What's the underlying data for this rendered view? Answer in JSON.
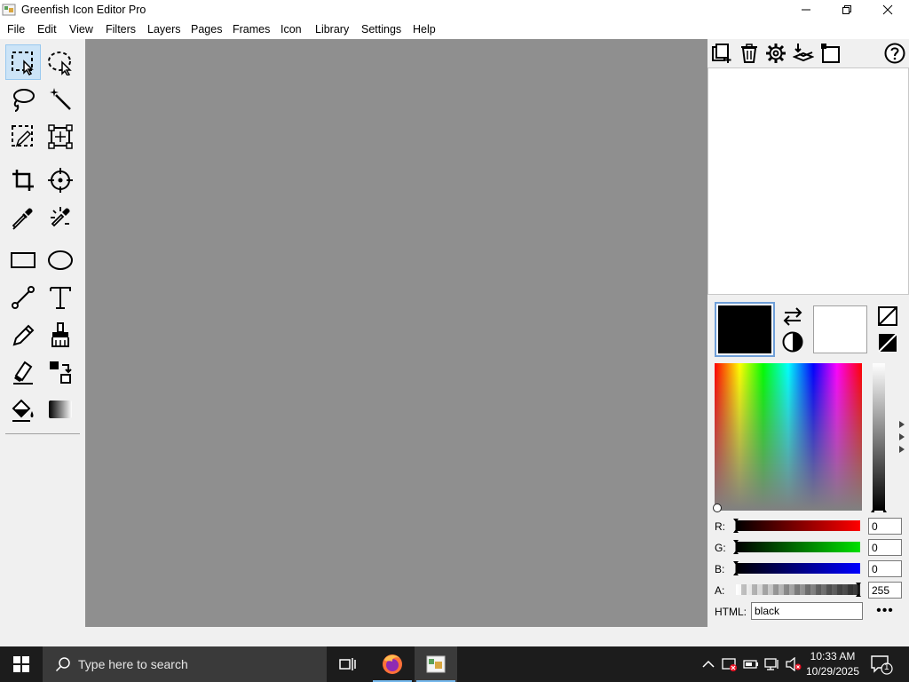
{
  "window": {
    "title": "Greenfish Icon Editor Pro",
    "icon": "app-icon"
  },
  "menu": [
    "File",
    "Edit",
    "View",
    "Filters",
    "Layers",
    "Pages",
    "Frames",
    "Icon",
    "Library",
    "Settings",
    "Help"
  ],
  "tools": [
    {
      "name": "rectangle-select-tool",
      "icon": "rect-select-icon",
      "active": true
    },
    {
      "name": "ellipse-select-tool",
      "icon": "ellipse-select-icon"
    },
    {
      "name": "lasso-tool",
      "icon": "lasso-icon"
    },
    {
      "name": "magic-wand-tool",
      "icon": "magic-wand-icon"
    },
    {
      "name": "draw-selection-tool",
      "icon": "pencil-select-icon"
    },
    {
      "name": "transform-tool",
      "icon": "transform-icon"
    },
    {
      "name": "crop-tool",
      "icon": "crop-icon"
    },
    {
      "name": "hotspot-tool",
      "icon": "target-icon"
    },
    {
      "name": "color-picker-tool",
      "icon": "eyedropper-icon"
    },
    {
      "name": "smart-picker-tool",
      "icon": "picker-spark-icon"
    },
    {
      "name": "rectangle-tool",
      "icon": "rectangle-icon"
    },
    {
      "name": "ellipse-tool",
      "icon": "ellipse-icon"
    },
    {
      "name": "line-tool",
      "icon": "line-icon"
    },
    {
      "name": "text-tool",
      "icon": "text-icon"
    },
    {
      "name": "pencil-tool",
      "icon": "pencil-icon"
    },
    {
      "name": "brush-tool",
      "icon": "brush-icon"
    },
    {
      "name": "eraser-tool",
      "icon": "eraser-icon"
    },
    {
      "name": "color-replacer-tool",
      "icon": "color-replace-icon"
    },
    {
      "name": "fill-tool",
      "icon": "paint-bucket-icon"
    },
    {
      "name": "gradient-tool",
      "icon": "gradient-icon"
    }
  ],
  "layers_toolbar": [
    "new-layer-icon",
    "delete-layer-icon",
    "layer-properties-icon",
    "merge-layers-icon",
    "page-icon",
    "help-icon"
  ],
  "colors": {
    "primary": "#000000",
    "secondary": "#ffffff",
    "accent": "#6f9fd8",
    "canvas": "#8f8f8f"
  },
  "channels": [
    {
      "label": "R:",
      "value": "0",
      "color": "#ff0000"
    },
    {
      "label": "G:",
      "value": "0",
      "color": "#00e000"
    },
    {
      "label": "B:",
      "value": "0",
      "color": "#0000ff"
    },
    {
      "label": "A:",
      "value": "255",
      "color": "#444444"
    }
  ],
  "html_field": {
    "label": "HTML:",
    "value": "black"
  },
  "more_button": "•••",
  "taskbar": {
    "search_placeholder": "Type here to search",
    "time": "10:33 AM",
    "date": "10/29/2025",
    "notifications": "1"
  }
}
